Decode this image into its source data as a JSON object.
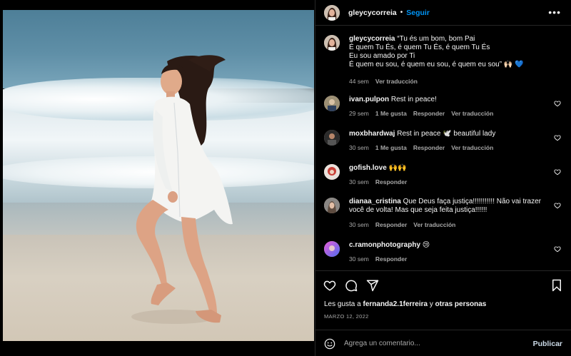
{
  "post": {
    "username": "gleycycorreia",
    "follow_label": "Seguir",
    "more_icon": "more-horizontal-icon"
  },
  "caption": {
    "username": "gleycycorreia",
    "line1": "“Tu és um bom, bom Pai",
    "line2": "É quem Tu És, é quem Tu És, é quem Tu És",
    "line3": "Eu sou amado por Ti",
    "line4": "É quem eu sou, é quem eu sou, é quem eu sou” 🙌🏻 💙",
    "time": "44 sem",
    "translate": "Ver traducción"
  },
  "comments": [
    {
      "username": "ivan.pulpon",
      "text": "Rest in peace!",
      "time": "29 sem",
      "likes": "1 Me gusta",
      "reply": "Responder",
      "translate": "Ver traducción",
      "avatar_color": "#8b7a5a"
    },
    {
      "username": "moxbhardwaj",
      "text": "Rest in peace 🕊️ beautiful lady",
      "time": "30 sem",
      "likes": "1 Me gusta",
      "reply": "Responder",
      "translate": "Ver traducción",
      "avatar_color": "#3a3a3a"
    },
    {
      "username": "gofish.love",
      "text": "🙌🙌",
      "time": "30 sem",
      "likes": "",
      "reply": "Responder",
      "translate": "",
      "avatar_color": "#c84038"
    },
    {
      "username": "dianaa_cristina",
      "text_line1": "Que Deus faça justiça!!!!!!!!!!! Não vai trazer",
      "text_line2": "você de volta! Mas que seja feita justiça!!!!!!",
      "time": "30 sem",
      "likes": "",
      "reply": "Responder",
      "translate": "Ver traducción",
      "avatar_color": "#8c8a88"
    },
    {
      "username": "c.ramonphotography",
      "text": "😢",
      "time": "30 sem",
      "likes": "",
      "reply": "Responder",
      "translate": "",
      "avatar_color": "#6a6fd8"
    }
  ],
  "actions": {
    "like_icon": "heart-icon",
    "comment_icon": "comment-icon",
    "share_icon": "send-icon",
    "save_icon": "bookmark-icon"
  },
  "likes": {
    "prefix": "Les gusta a",
    "user": "fernanda2.1ferreira",
    "suffix_connector": "y",
    "others": "otras personas"
  },
  "date": "MARZO 12, 2022",
  "composer": {
    "placeholder": "Agrega un comentario...",
    "publish": "Publicar",
    "emoji_icon": "emoji-icon"
  },
  "colors": {
    "accent": "#0095f6",
    "background": "#000000",
    "muted": "#a8a8a8",
    "divider": "#262626"
  }
}
